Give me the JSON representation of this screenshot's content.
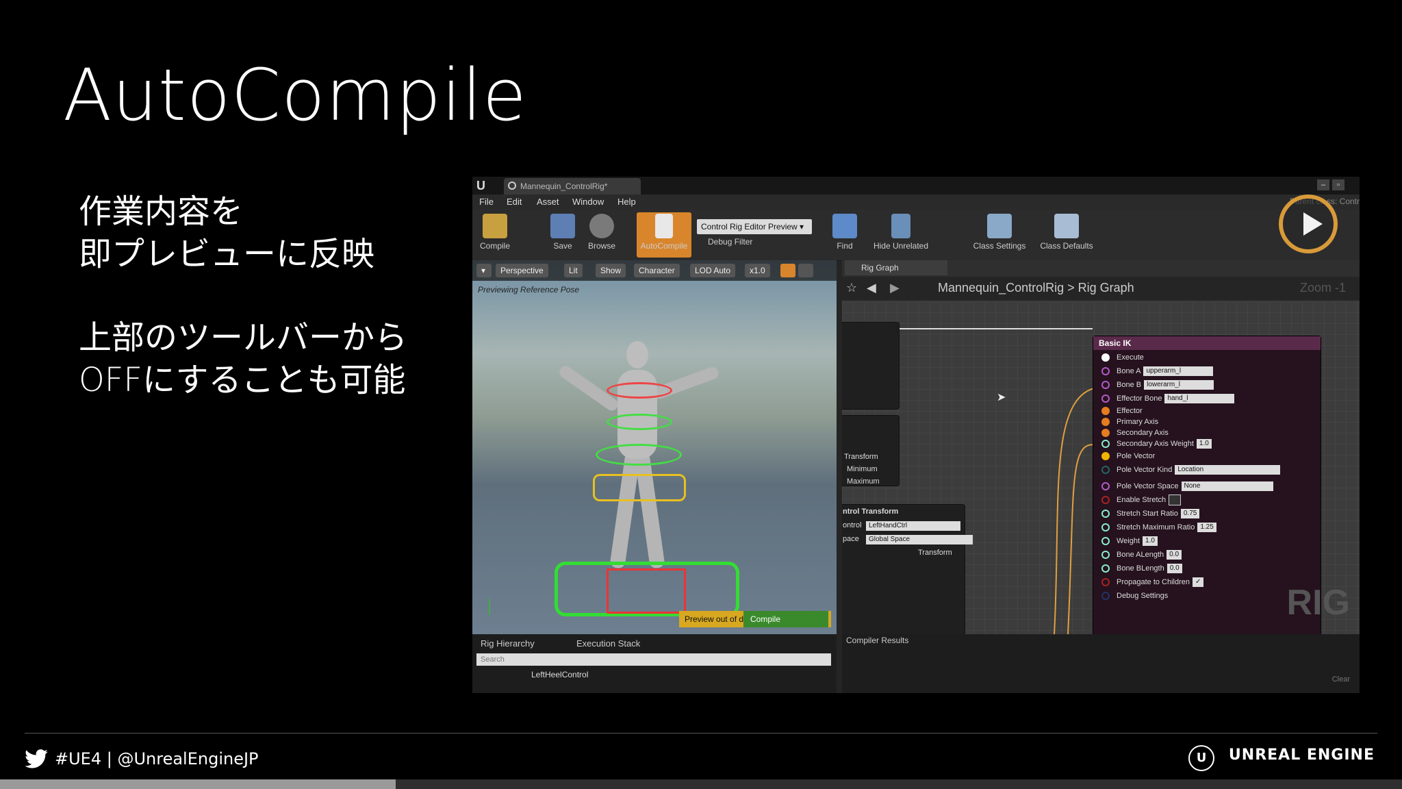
{
  "slide": {
    "title": "AutoCompile",
    "para1": [
      "作業内容を",
      "即プレビューに反映"
    ],
    "para2": [
      "上部のツールバーから",
      "OFFにすることも可能"
    ]
  },
  "editor": {
    "window_tab": "Mannequin_ControlRig*",
    "class_hint": "Parent class: Contr",
    "menu": [
      "File",
      "Edit",
      "Asset",
      "Window",
      "Help"
    ],
    "toolbar": {
      "compile": "Compile",
      "save": "Save",
      "browse": "Browse",
      "autocompile": "AutoCompile",
      "preview_select": "Control Rig Editor Preview",
      "debug_filter": "Debug Filter",
      "find": "Find",
      "hide_unrelated": "Hide Unrelated",
      "class_settings": "Class Settings",
      "class_defaults": "Class Defaults"
    },
    "viewport": {
      "buttons": [
        "Perspective",
        "Lit",
        "Show",
        "Character",
        "LOD Auto",
        "x1.0"
      ],
      "note": "Previewing Reference Pose",
      "status": "Preview out of date",
      "compile": "Compile"
    },
    "hierarchy": {
      "tabs": [
        "Rig Hierarchy",
        "Execution Stack"
      ],
      "search_placeholder": "Search",
      "item": "LeftHeelControl"
    },
    "graph": {
      "tab": "Rig Graph",
      "breadcrumb": "Mannequin_ControlRig  >  Rig Graph",
      "zoom": "Zoom -1",
      "left_node_pins": [
        "Transform",
        "Minimum",
        "Maximum"
      ],
      "control_transform": {
        "title": "ntrol Transform",
        "control_label": "ontrol",
        "control_value": "LeftHandCtrl",
        "space_label": "pace",
        "space_value": "Global Space",
        "out_pin": "Transform"
      },
      "basic_ik": {
        "title": "Basic IK",
        "rows": [
          {
            "label": "Execute",
            "value": ""
          },
          {
            "label": "Bone A",
            "value": "upperarm_l"
          },
          {
            "label": "Bone B",
            "value": "lowerarm_l"
          },
          {
            "label": "Effector Bone",
            "value": "hand_l"
          },
          {
            "label": "Effector",
            "value": ""
          },
          {
            "label": "Primary Axis",
            "value": ""
          },
          {
            "label": "Secondary Axis",
            "value": ""
          },
          {
            "label": "Secondary Axis Weight",
            "value": "1.0"
          },
          {
            "label": "Pole Vector",
            "value": ""
          },
          {
            "label": "Pole Vector Kind",
            "value": "Location"
          },
          {
            "label": "Pole Vector Space",
            "value": "None"
          },
          {
            "label": "Enable Stretch",
            "value": ""
          },
          {
            "label": "Stretch Start Ratio",
            "value": "0.75"
          },
          {
            "label": "Stretch Maximum Ratio",
            "value": "1.25"
          },
          {
            "label": "Weight",
            "value": "1.0"
          },
          {
            "label": "Bone ALength",
            "value": "0.0"
          },
          {
            "label": "Bone BLength",
            "value": "0.0"
          },
          {
            "label": "Propagate to Children",
            "value": ""
          },
          {
            "label": "Debug Settings",
            "value": ""
          }
        ]
      },
      "watermark": "RIG"
    },
    "compiler": {
      "tab": "Compiler Results",
      "clear": "Clear"
    }
  },
  "footer": {
    "hashtag": "#UE4 | @UnrealEngineJP",
    "brand": "UNREAL ENGINE"
  },
  "progress": 0.282,
  "colors": {
    "accent": "#d9852b",
    "node_header": "#5a2a4a"
  }
}
